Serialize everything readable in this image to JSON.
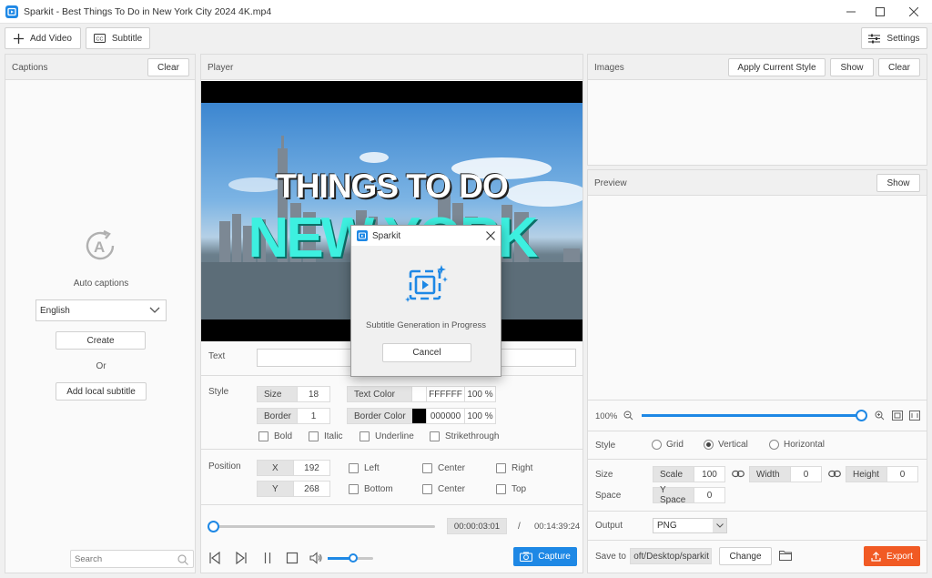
{
  "window": {
    "title": "Sparkit - Best Things To Do in New York City 2024 4K.mp4"
  },
  "toolbar": {
    "add_video": "Add Video",
    "subtitle": "Subtitle",
    "settings": "Settings"
  },
  "captions": {
    "title": "Captions",
    "clear": "Clear",
    "auto_captions": "Auto captions",
    "language": "English",
    "create": "Create",
    "or": "Or",
    "add_local": "Add local subtitle",
    "search_placeholder": "Search"
  },
  "player": {
    "title": "Player",
    "video_line1": "THINGS TO DO",
    "video_line2": "NEW YORK",
    "text_label": "Text",
    "style_label": "Style",
    "size_key": "Size",
    "size_val": "18",
    "border_key": "Border",
    "border_val": "1",
    "text_color_key": "Text Color",
    "text_color_hex": "FFFFFF",
    "text_color_pct": "100 %",
    "border_color_key": "Border Color",
    "border_color_hex": "000000",
    "border_color_pct": "100 %",
    "bold": "Bold",
    "italic": "Italic",
    "underline": "Underline",
    "strikethrough": "Strikethrough",
    "position_label": "Position",
    "x_key": "X",
    "x_val": "192",
    "y_key": "Y",
    "y_val": "268",
    "left": "Left",
    "center1": "Center",
    "right": "Right",
    "bottom": "Bottom",
    "center2": "Center",
    "top": "Top",
    "current_time": "00:00:03:01",
    "slash": "/",
    "total_time": "00:14:39:24",
    "capture": "Capture",
    "progress": 0.0,
    "volume": 0.55
  },
  "images": {
    "title": "Images",
    "apply_style": "Apply Current Style",
    "show": "Show",
    "clear": "Clear"
  },
  "preview": {
    "title": "Preview",
    "show": "Show",
    "zoom": "100%",
    "zoom_level": 1.0,
    "style_label": "Style",
    "grid": "Grid",
    "vertical": "Vertical",
    "horizontal": "Horizontal",
    "size_label": "Size",
    "space_label": "Space",
    "scale_key": "Scale",
    "scale_val": "100",
    "width_key": "Width",
    "width_val": "0",
    "height_key": "Height",
    "height_val": "0",
    "yspace_key": "Y Space",
    "yspace_val": "0",
    "output_label": "Output",
    "output_val": "PNG",
    "save_to_label": "Save to",
    "save_path": "oft/Desktop/sparkit",
    "change": "Change",
    "export": "Export"
  },
  "dialog": {
    "title": "Sparkit",
    "message": "Subtitle Generation in Progress",
    "cancel": "Cancel"
  },
  "colors": {
    "accent": "#1e88e5",
    "export": "#f15a24",
    "video_title": "#ffffff",
    "video_city": "#3df0e0",
    "slider": "#1e88e5"
  }
}
